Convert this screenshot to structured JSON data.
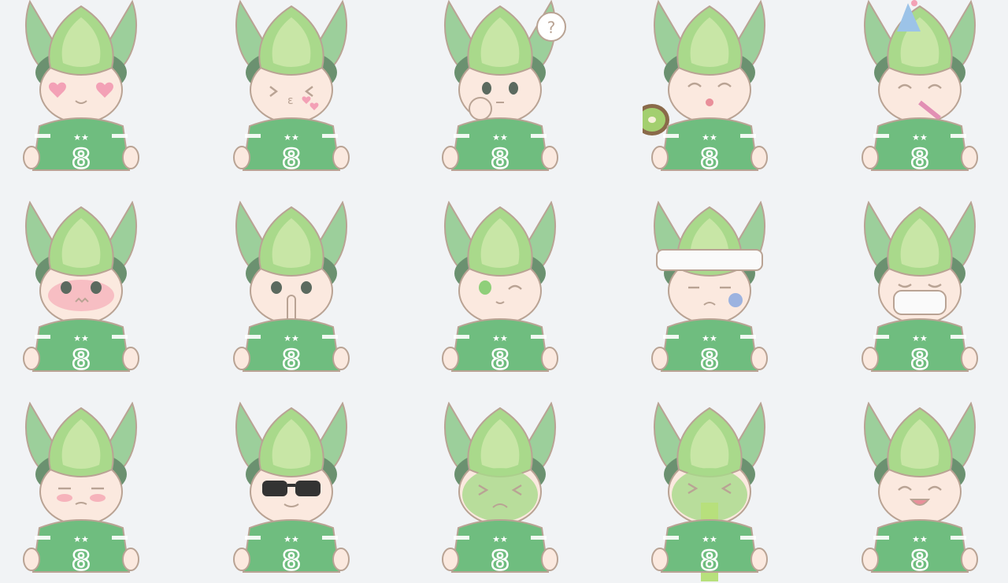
{
  "colors": {
    "background": "#f1f3f5",
    "leaf_light": "#c8e6a6",
    "leaf_mid": "#a9d98b",
    "wing": "#9ccf9b",
    "jersey": "#6fbd7f",
    "jersey_trim": "#ffffff",
    "skin": "#fbe9df",
    "outline": "#b9a394",
    "hair": "#6b9170"
  },
  "jersey_number": "8",
  "jersey_stars": "★★",
  "stickers": [
    {
      "expression": "heart-eyes",
      "row": 1,
      "col": 1
    },
    {
      "expression": "blowing-kiss",
      "row": 1,
      "col": 2
    },
    {
      "expression": "confused-question",
      "row": 1,
      "col": 3,
      "bubble": "?"
    },
    {
      "expression": "eating-kiwi",
      "row": 1,
      "col": 4
    },
    {
      "expression": "party-celebration",
      "row": 1,
      "col": 5
    },
    {
      "expression": "blushing",
      "row": 2,
      "col": 1
    },
    {
      "expression": "shush",
      "row": 2,
      "col": 2
    },
    {
      "expression": "wink",
      "row": 2,
      "col": 3
    },
    {
      "expression": "injured-bandage",
      "row": 2,
      "col": 4
    },
    {
      "expression": "sick-mask",
      "row": 2,
      "col": 5
    },
    {
      "expression": "smug-annoyed",
      "row": 3,
      "col": 1
    },
    {
      "expression": "sunglasses",
      "row": 3,
      "col": 2
    },
    {
      "expression": "nauseous-green",
      "row": 3,
      "col": 3
    },
    {
      "expression": "vomiting",
      "row": 3,
      "col": 4
    },
    {
      "expression": "happy-laughing",
      "row": 3,
      "col": 5
    }
  ]
}
